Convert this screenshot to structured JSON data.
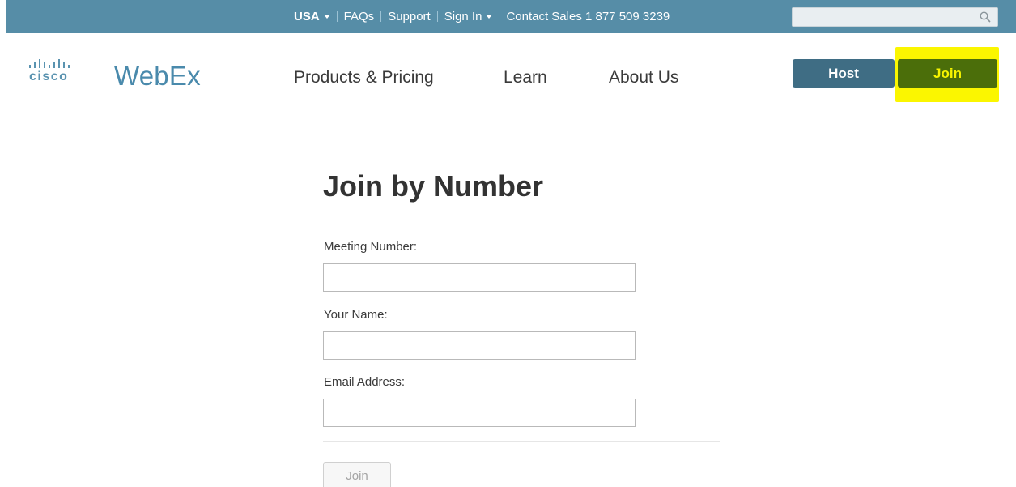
{
  "topbar": {
    "items": [
      {
        "label": "USA",
        "dropdown": true
      },
      {
        "label": "FAQs"
      },
      {
        "label": "Support"
      },
      {
        "label": "Sign In",
        "dropdown": true
      },
      {
        "label": "Contact Sales 1 877 509 3239"
      }
    ],
    "search": {
      "placeholder": "",
      "icon": "search-icon"
    }
  },
  "header": {
    "logo_text": "cisco",
    "brand": "WebEx",
    "nav": [
      "Products & Pricing",
      "Learn",
      "About Us"
    ],
    "host_button": "Host",
    "join_button": "Join",
    "colors": {
      "topbar_bg": "#568da7",
      "host_bg": "#3f6d84",
      "join_bg": "#4b6e0a",
      "highlight": "#fbf600"
    }
  },
  "form": {
    "title": "Join by Number",
    "fields": [
      {
        "label": "Meeting Number:",
        "value": ""
      },
      {
        "label": "Your Name:",
        "value": ""
      },
      {
        "label": "Email Address:",
        "value": ""
      }
    ],
    "submit_label": "Join",
    "submit_disabled": true
  }
}
